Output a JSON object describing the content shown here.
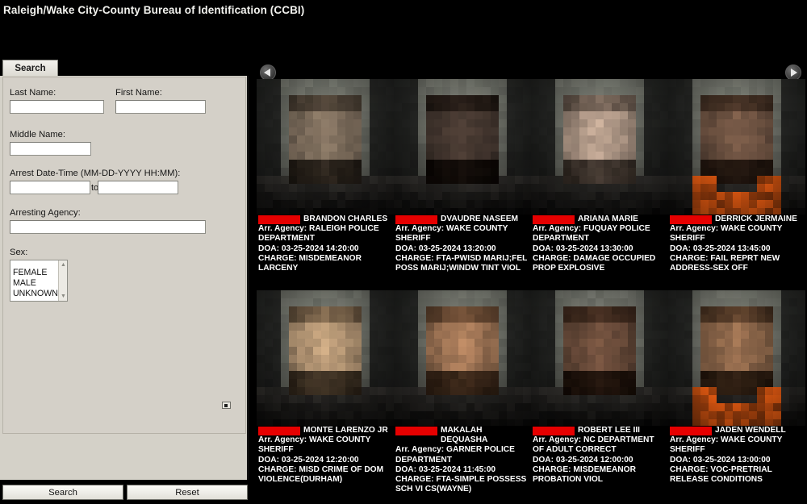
{
  "app": {
    "title": "Raleigh/Wake City-County Bureau of Identification (CCBI)"
  },
  "tabs": [
    {
      "label": "Search",
      "selected": true
    }
  ],
  "search_form": {
    "fields": {
      "last_name": {
        "label": "Last Name:",
        "value": ""
      },
      "first_name": {
        "label": "First Name:",
        "value": ""
      },
      "middle_name": {
        "label": "Middle Name:",
        "value": ""
      },
      "arrest_date_time": {
        "label": "Arrest Date-Time (MM-DD-YYYY HH:MM):",
        "from_value": "",
        "to_value": "",
        "separator": "to"
      },
      "arresting_agency": {
        "label": "Arresting Agency:",
        "value": ""
      },
      "sex": {
        "label": "Sex:",
        "options": [
          "FEMALE",
          "MALE",
          "UNKNOWN"
        ],
        "selected": ""
      }
    },
    "buttons": {
      "search": "Search",
      "reset": "Reset"
    }
  },
  "results": {
    "nav": {
      "prev": "◀",
      "next": "▶"
    },
    "redacted_label": "",
    "records": [
      {
        "last_name_redacted": true,
        "first_middle": "BRANDON CHARLES",
        "agency_label": "Arr. Agency:",
        "agency": "RALEIGH POLICE DEPARTMENT",
        "doa_label": "DOA:",
        "doa": "03-25-2024 14:20:00",
        "charge_label": "CHARGE:",
        "charge": "MISDEMEANOR LARCENY",
        "photo_tone": "#8d7a66"
      },
      {
        "last_name_redacted": true,
        "first_middle": "DVAUDRE NASEEM",
        "agency_label": "Arr. Agency:",
        "agency": "WAKE COUNTY SHERIFF",
        "doa_label": "DOA:",
        "doa": "03-25-2024 13:20:00",
        "charge_label": "CHARGE:",
        "charge": "FTA-PWISD MARIJ;FEL POSS MARIJ;WINDW TINT VIOL",
        "photo_tone": "#4a3a31"
      },
      {
        "last_name_redacted": true,
        "first_middle": "ARIANA MARIE",
        "agency_label": "Arr. Agency:",
        "agency": "FUQUAY POLICE DEPARTMENT",
        "doa_label": "DOA:",
        "doa": "03-25-2024 13:30:00",
        "charge_label": "CHARGE:",
        "charge": "DAMAGE OCCUPIED PROP EXPLOSIVE",
        "photo_tone": "#c4a995"
      },
      {
        "last_name_redacted": true,
        "first_middle": "DERRICK JERMAINE",
        "agency_label": "Arr. Agency:",
        "agency": "WAKE COUNTY SHERIFF",
        "doa_label": "DOA:",
        "doa": "03-25-2024 13:45:00",
        "charge_label": "CHARGE:",
        "charge": "FAIL REPRT NEW ADDRESS-SEX OFF",
        "photo_tone": "#7a5a46"
      },
      {
        "last_name_redacted": true,
        "first_middle": "MONTE LARENZO JR",
        "agency_label": "Arr. Agency:",
        "agency": "WAKE COUNTY SHERIFF",
        "doa_label": "DOA:",
        "doa": "03-25-2024 12:20:00",
        "charge_label": "CHARGE:",
        "charge": "MISD CRIME OF DOM VIOLENCE(DURHAM)",
        "photo_tone": "#c9a67f"
      },
      {
        "last_name_redacted": true,
        "first_middle": "MAKALAH DEQUASHA",
        "agency_label": "Arr. Agency:",
        "agency": "GARNER POLICE DEPARTMENT",
        "doa_label": "DOA:",
        "doa": "03-25-2024 11:45:00",
        "charge_label": "CHARGE:",
        "charge": "FTA-SIMPLE POSSESS SCH VI CS(WAYNE)",
        "photo_tone": "#b3815c"
      },
      {
        "last_name_redacted": true,
        "first_middle": "ROBERT LEE III",
        "agency_label": "Arr. Agency:",
        "agency": "NC DEPARTMENT OF ADULT CORRECT",
        "doa_label": "DOA:",
        "doa": "03-25-2024 12:00:00",
        "charge_label": "CHARGE:",
        "charge": "MISDEMEANOR PROBATION VIOL",
        "photo_tone": "#73503c"
      },
      {
        "last_name_redacted": true,
        "first_middle": "JADEN WENDELL",
        "agency_label": "Arr. Agency:",
        "agency": "WAKE COUNTY SHERIFF",
        "doa_label": "DOA:",
        "doa": "03-25-2024 13:00:00",
        "charge_label": "CHARGE:",
        "charge": "VOC-PRETRIAL RELEASE CONDITIONS",
        "photo_tone": "#9b6f4e"
      }
    ]
  },
  "colors": {
    "background": "#000000",
    "panel": "#d4d0c8",
    "redaction": "#e60000",
    "text_light": "#ffffff",
    "title": "#f2f2ee"
  }
}
